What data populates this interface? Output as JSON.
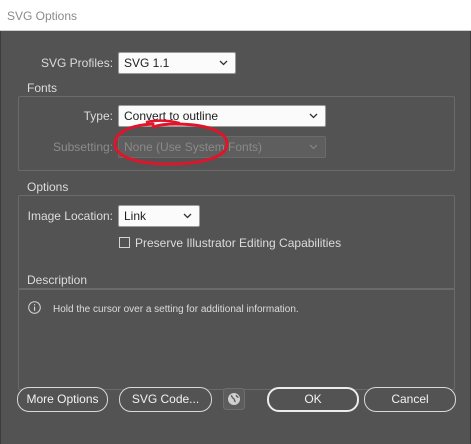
{
  "window": {
    "title": "SVG Options"
  },
  "profile": {
    "label": "SVG Profiles:",
    "value": "SVG 1.1"
  },
  "fonts": {
    "title": "Fonts",
    "type_label": "Type:",
    "type_value": "Convert to outline",
    "subsetting_label": "Subsetting:",
    "subsetting_value": "None (Use System Fonts)"
  },
  "options": {
    "title": "Options",
    "image_location_label": "Image Location:",
    "image_location_value": "Link",
    "preserve_label": "Preserve Illustrator Editing Capabilities",
    "preserve_checked": false
  },
  "description": {
    "title": "Description",
    "text": "Hold the cursor over a setting for additional information."
  },
  "buttons": {
    "more_options": "More Options",
    "svg_code": "SVG Code...",
    "ok": "OK",
    "cancel": "Cancel"
  },
  "icons": {
    "chevron": "chevron-down-icon",
    "info": "info-icon",
    "globe": "globe-icon"
  },
  "colors": {
    "dialog_bg": "#535353",
    "annotation": "#e0142a"
  }
}
